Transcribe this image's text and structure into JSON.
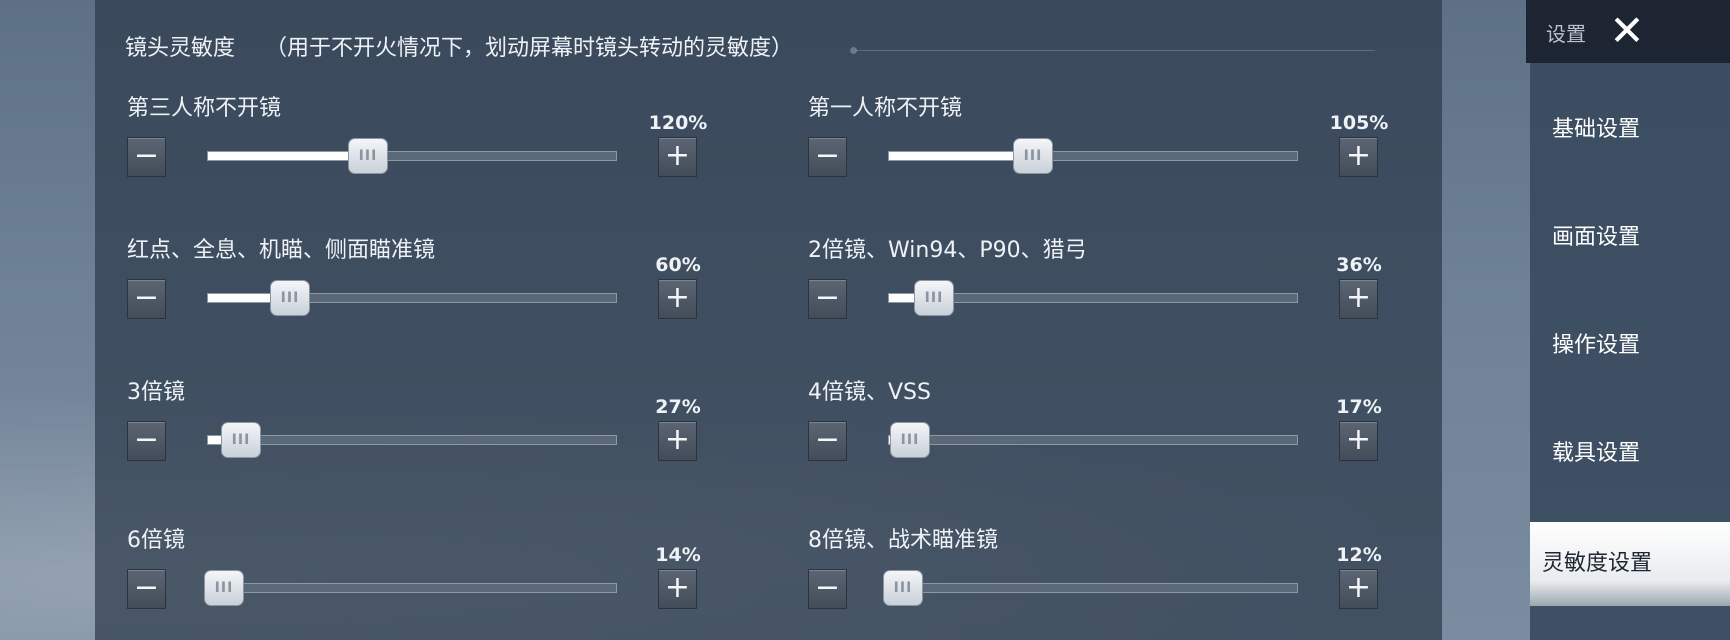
{
  "header": {
    "title": "镜头灵敏度",
    "note": "（用于不开火情况下，划动屏幕时镜头转动的灵敏度）"
  },
  "sidebar": {
    "title": "设置",
    "items": [
      {
        "label": "基础设置",
        "active": false
      },
      {
        "label": "画面设置",
        "active": false
      },
      {
        "label": "操作设置",
        "active": false
      },
      {
        "label": "载具设置",
        "active": false
      },
      {
        "label": "灵敏度设置",
        "active": true
      }
    ]
  },
  "buttons": {
    "minus": "−",
    "plus": "+"
  },
  "thumb_grip": "III",
  "close_icon": "✕",
  "settings": [
    {
      "label": "第三人称不开镜",
      "value": "120%",
      "level": 0.39
    },
    {
      "label": "第一人称不开镜",
      "value": "105%",
      "level": 0.35
    },
    {
      "label": "红点、全息、机瞄、侧面瞄准镜",
      "value": "60%",
      "level": 0.2
    },
    {
      "label": "2倍镜、Win94、P90、猎弓",
      "value": "36%",
      "level": 0.11
    },
    {
      "label": "3倍镜",
      "value": "27%",
      "level": 0.08
    },
    {
      "label": "4倍镜、VSS",
      "value": "17%",
      "level": 0.05
    },
    {
      "label": "6倍镜",
      "value": "14%",
      "level": 0.04
    },
    {
      "label": "8倍镜、战术瞄准镜",
      "value": "12%",
      "level": 0.03
    }
  ],
  "colors": {
    "fill": "#ffffff",
    "panel": "#2c3a4b",
    "active_tab": "#ffffff"
  }
}
